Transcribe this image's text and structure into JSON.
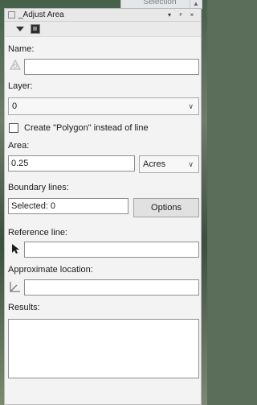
{
  "background_tab": {
    "label": "Selection"
  },
  "panel": {
    "title": "_Adjust Area",
    "controls": {
      "dropdown": "▾",
      "pin": "ᵖ",
      "close": "×"
    }
  },
  "name": {
    "label": "Name:",
    "value": ""
  },
  "layer": {
    "label": "Layer:",
    "value": "0"
  },
  "polygon_option": {
    "label": "Create \"Polygon\" instead of line",
    "checked": false
  },
  "area": {
    "label": "Area:",
    "value": "0.25",
    "unit": "Acres"
  },
  "boundary": {
    "label": "Boundary lines:",
    "value": "Selected: 0",
    "options_button": "Options"
  },
  "reference": {
    "label": "Reference line:",
    "value": ""
  },
  "location": {
    "label": "Approximate location:",
    "value": ""
  },
  "results": {
    "label": "Results:",
    "value": ""
  },
  "icons": {
    "name": "polygon-tool-icon",
    "reference": "pointer-arrow-icon",
    "location": "angle-measure-icon"
  },
  "colors": {
    "panel_bg": "#f3f3f3",
    "field_border": "#8e8e8e"
  }
}
